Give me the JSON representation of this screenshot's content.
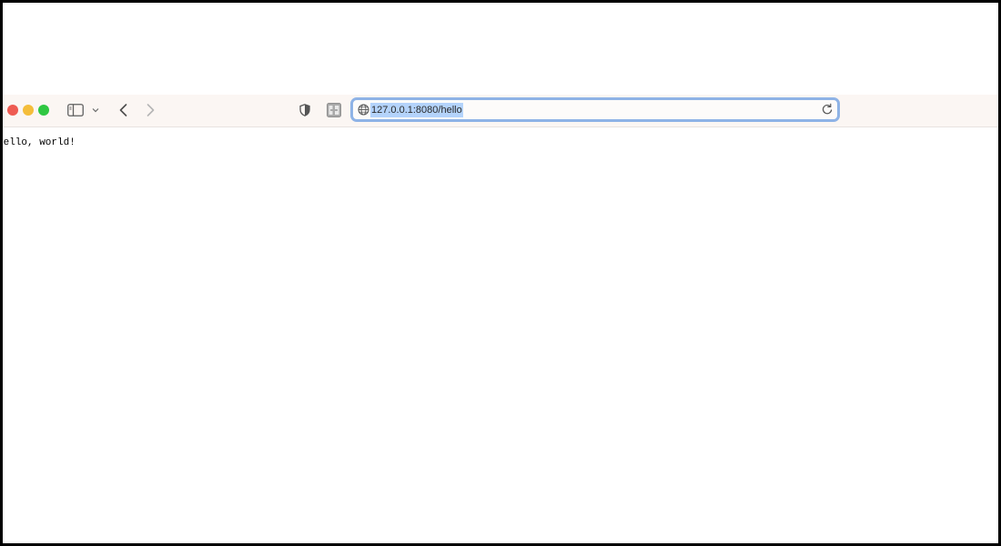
{
  "browser": {
    "address_bar": {
      "url": "127.0.0.1:8080/hello"
    },
    "icons": {
      "close": "close-traffic-light",
      "minimize": "minimize-traffic-light",
      "maximize": "maximize-traffic-light",
      "sidebar": "sidebar-icon",
      "sidebar_menu": "chevron-down-icon",
      "back": "chevron-left-icon",
      "forward": "chevron-right-icon",
      "privacy": "shield-icon",
      "extension": "extension-icon",
      "site": "globe-icon",
      "reload": "reload-icon"
    },
    "colors": {
      "close": "#ee5b52",
      "minimize": "#f4bd3a",
      "maximize": "#2fc742",
      "focus_ring": "#8fb3e6",
      "selection": "#b4d3fb"
    }
  },
  "page": {
    "body_text": "Hello, world!"
  }
}
